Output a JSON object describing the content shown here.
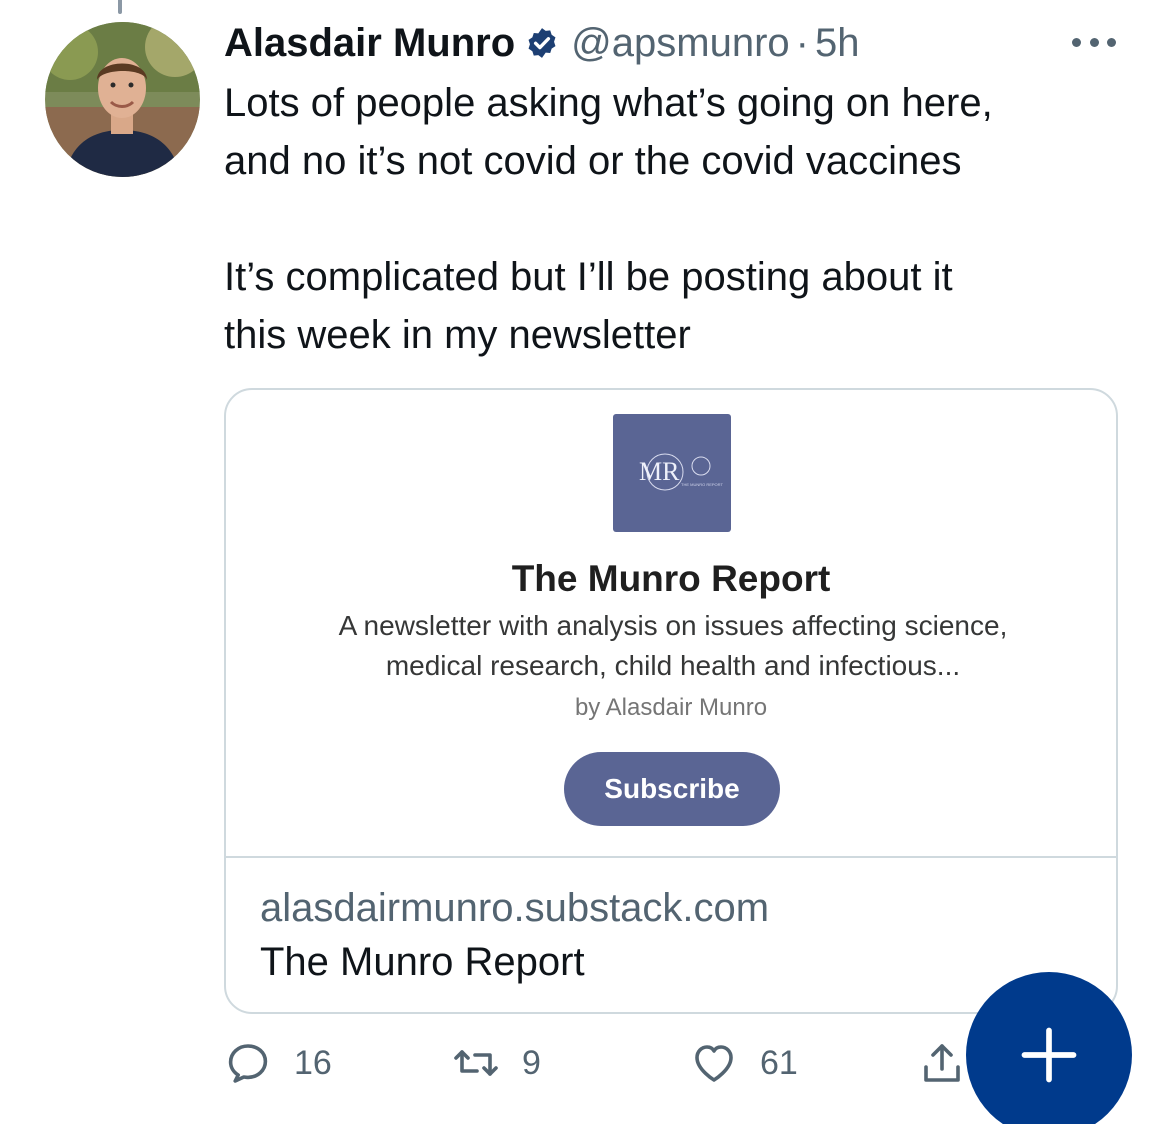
{
  "tweet": {
    "author": {
      "display_name": "Alasdair Munro",
      "handle": "@apsmunro",
      "verified": true,
      "avatar_icon": "avatar-photo"
    },
    "separator": "·",
    "time": "5h",
    "more_icon": "more-dots-icon",
    "text_paragraphs": [
      [
        "Lots of people asking what’s going on here,",
        "and no it’s not covid or the covid vaccines"
      ],
      [
        "It’s complicated but I’ll be posting about it",
        "this week in my newsletter"
      ]
    ]
  },
  "card": {
    "logo_icon": "munro-report-logo",
    "logo_text": "MR",
    "logo_subtext": "THE MUNRO REPORT",
    "title": "The Munro Report",
    "description_lines": [
      "A newsletter with analysis on issues affecting science,",
      "medical research, child health and infectious..."
    ],
    "byline": "by Alasdair Munro",
    "subscribe_label": "Subscribe",
    "domain": "alasdairmunro.substack.com",
    "link_title": "The Munro Report",
    "accent_color": "#5a6594"
  },
  "actions": {
    "reply": {
      "icon": "reply-icon",
      "count": "16"
    },
    "retweet": {
      "icon": "retweet-icon",
      "count": "9"
    },
    "like": {
      "icon": "heart-icon",
      "count": "61"
    },
    "share": {
      "icon": "share-icon"
    }
  },
  "compose_button": {
    "icon": "plus-icon",
    "color": "#003a8c"
  },
  "colors": {
    "text_primary": "#0f1419",
    "text_secondary": "#536471",
    "verified_badge": "#1d3f73"
  }
}
